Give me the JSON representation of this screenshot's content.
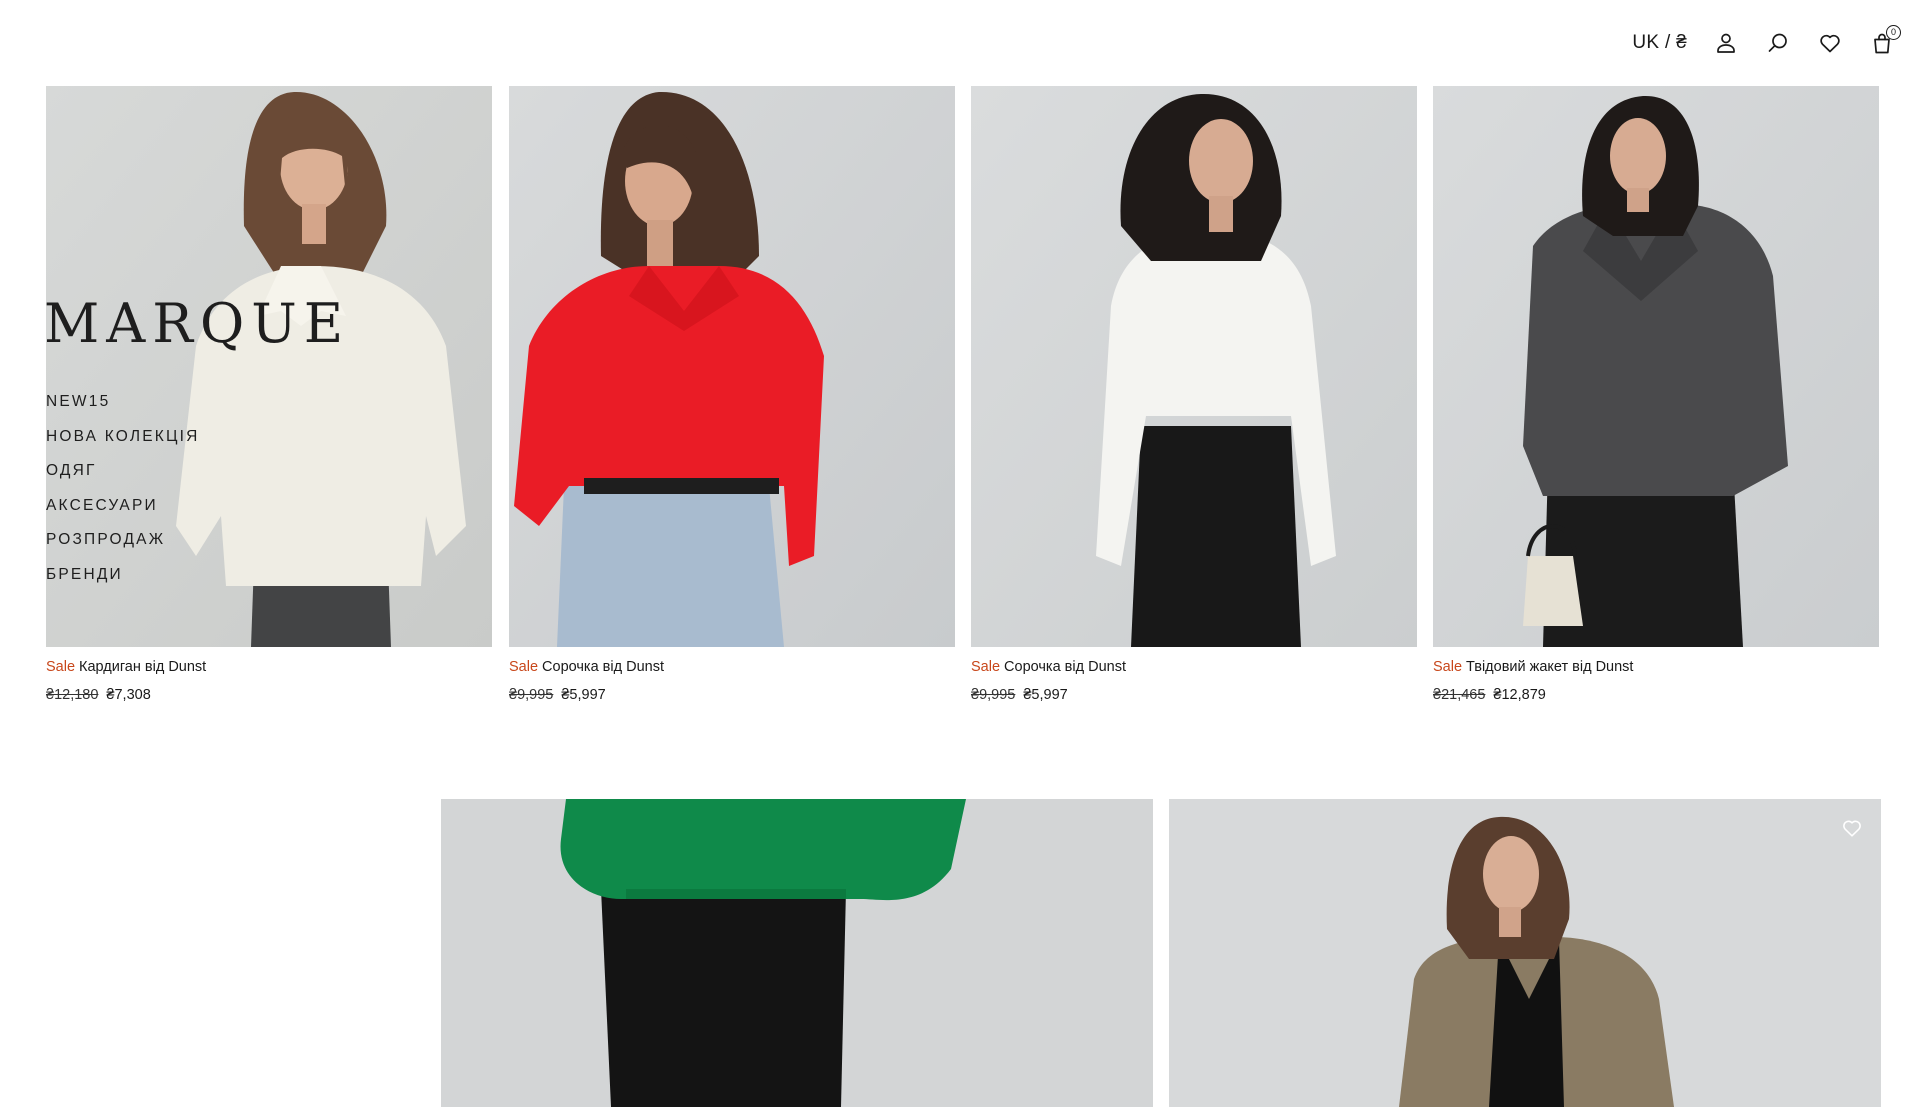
{
  "header": {
    "lang_currency": "UK / ₴",
    "icons": [
      "user-icon",
      "search-icon",
      "heart-icon",
      "bag-icon"
    ],
    "cart_count": "0"
  },
  "brand": {
    "logo": "MARQUE"
  },
  "menu": {
    "items": [
      {
        "label": "NEW15"
      },
      {
        "label": "НОВА КОЛЕКЦІЯ"
      },
      {
        "label": "ОДЯГ"
      },
      {
        "label": "АКСЕСУАРИ"
      },
      {
        "label": "РОЗПРОДАЖ"
      },
      {
        "label": "БРЕНДИ"
      }
    ]
  },
  "products": [
    {
      "badge": "Sale",
      "name": "Кардиган від Dunst",
      "old_price": "₴12,180",
      "price": "₴7,308"
    },
    {
      "badge": "Sale",
      "name": "Сорочка від Dunst",
      "old_price": "₴9,995",
      "price": "₴5,997"
    },
    {
      "badge": "Sale",
      "name": "Сорочка від Dunst",
      "old_price": "₴9,995",
      "price": "₴5,997"
    },
    {
      "badge": "Sale",
      "name": "Твідовий жакет від Dunst",
      "old_price": "₴21,465",
      "price": "₴12,879"
    }
  ],
  "colors": {
    "sale": "#c8471b",
    "photo_background": "#d6d8d9",
    "text": "#1a1a1a"
  }
}
